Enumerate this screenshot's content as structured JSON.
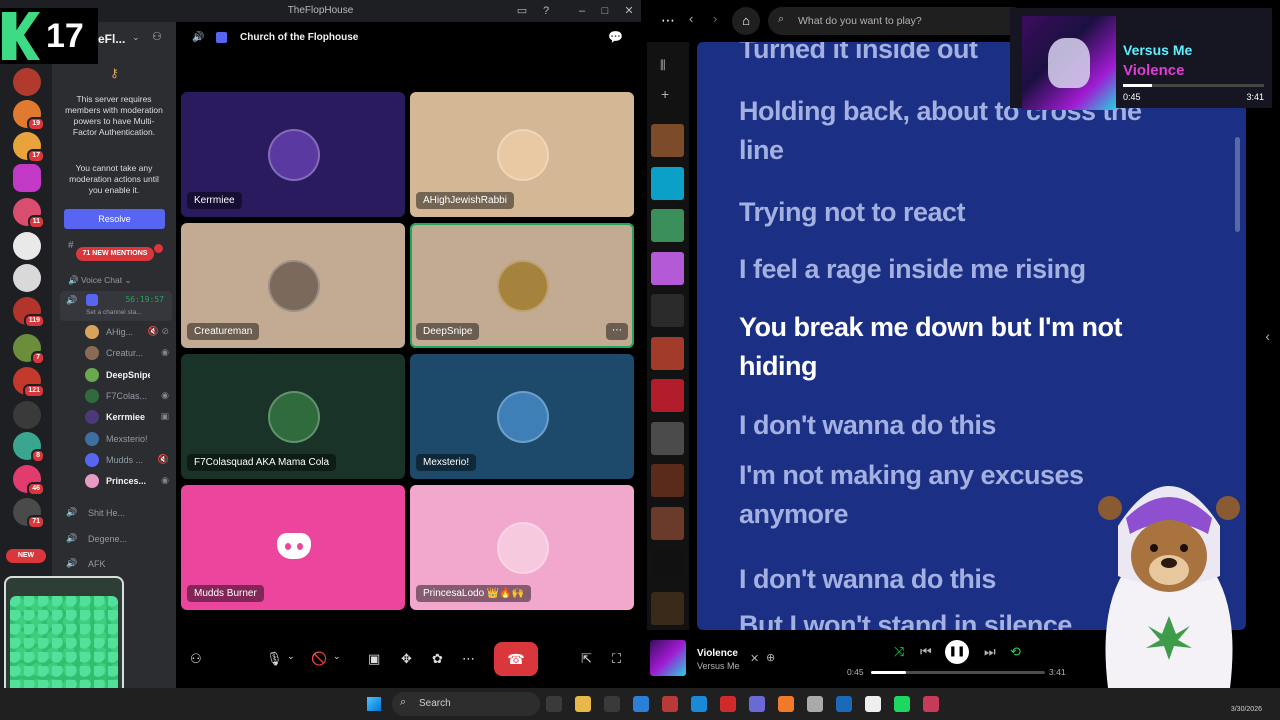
{
  "overlay": {
    "channel_number": "17"
  },
  "discord": {
    "window_title": "TheFlopHouse",
    "server_name_partial": "eFl...",
    "mfa_notice": "This server requires members with moderation powers to have Multi-Factor Authentication.",
    "mfa_notice2": "You cannot take any moderation actions until you enable it.",
    "resolve_label": "Resolve",
    "new_mentions": "71 NEW MENTIONS",
    "voice_category": "Voice Chat",
    "active_channel_timer": "56:19:57",
    "active_channel_status": "Set a channel sta...",
    "voice_members": [
      {
        "name": "AHig...",
        "bold": false,
        "icons": "🔇 ⊘",
        "color": "#d9a35c"
      },
      {
        "name": "Creatur...",
        "bold": false,
        "icons": "◉",
        "color": "#8a6a55"
      },
      {
        "name": "DeepSnipe",
        "bold": true,
        "icons": "",
        "color": "#6aa84f"
      },
      {
        "name": "F7Colas...",
        "bold": false,
        "icons": "◉",
        "color": "#2f6b3c"
      },
      {
        "name": "Kerrmiee",
        "bold": true,
        "icons": "▣",
        "color": "#4a3a7a"
      },
      {
        "name": "Mexsterio!",
        "bold": false,
        "icons": "",
        "color": "#3e6fa3"
      },
      {
        "name": "Mudds ...",
        "bold": false,
        "icons": "🔇",
        "color": "#5865f2"
      },
      {
        "name": "Princes...",
        "bold": true,
        "icons": "◉",
        "color": "#e79ac3"
      }
    ],
    "other_voice_channels": [
      {
        "name": "Shit He..."
      },
      {
        "name": "Degene..."
      },
      {
        "name": "AFK"
      }
    ],
    "stage_channel": "Church of the Flophouse",
    "guild_badges": [
      "19",
      "17",
      "11",
      "119",
      "7",
      "121",
      "8",
      "46",
      "71"
    ],
    "new_badge": "NEW",
    "tiles": [
      {
        "name": "Kerrmiee",
        "bg": "#2a1a5e",
        "speaking": false,
        "avatar": "#5a3aa0"
      },
      {
        "name": "AHighJewishRabbi",
        "bg": "#d4b896",
        "speaking": false,
        "avatar": "#e8c9a4"
      },
      {
        "name": "Creatureman",
        "bg": "#c3ab93",
        "speaking": false,
        "avatar": "#7b6a5c"
      },
      {
        "name": "DeepSnipe",
        "bg": "#c3ab93",
        "speaking": true,
        "avatar": "#a5833d"
      },
      {
        "name": "F7Colasquad AKA Mama Cola",
        "bg": "#1a3329",
        "speaking": false,
        "avatar": "#2f6b3c"
      },
      {
        "name": "Mexsterio!",
        "bg": "#1d4a6b",
        "speaking": false,
        "avatar": "#3e7fb8"
      },
      {
        "name": "Mudds Burner",
        "bg": "#eb459e",
        "speaking": false,
        "avatar": ""
      },
      {
        "name": "PrincesaLodo 👑🔥🙌",
        "bg": "#f2a7cc",
        "speaking": false,
        "avatar": "#f6c9df"
      }
    ]
  },
  "spotify": {
    "search_placeholder": "What do you want to play?",
    "lyrics": [
      {
        "text": "Turned it inside out",
        "active": false
      },
      {
        "text": "Holding back, about to cross the line",
        "active": false
      },
      {
        "text": "Trying not to react",
        "active": false
      },
      {
        "text": "I feel a rage inside me rising",
        "active": false
      },
      {
        "text": "You break me down but I'm not hiding",
        "active": true
      },
      {
        "text": "I don't wanna do this",
        "active": false
      },
      {
        "text": "I'm not making any excuses anymore",
        "active": false
      },
      {
        "text": "I don't wanna do this",
        "active": false
      },
      {
        "text": "But I won't stand in silence",
        "active": false
      }
    ],
    "mini_player": {
      "artist": "Versus Me",
      "title": "Violence",
      "elapsed": "0:45",
      "total": "3:41",
      "progress": 0.203
    },
    "now_playing": {
      "title": "Violence",
      "artist": "Versus Me",
      "elapsed": "0:45",
      "total": "3:41",
      "progress": 0.203
    }
  },
  "taskbar": {
    "search_label": "Search",
    "date": "3/30/2026"
  },
  "colors": {
    "discord_bg": "#1e1f22",
    "discord_accent": "#5865f2",
    "danger": "#da373c",
    "speaking": "#23a55a",
    "lyrics_bg": "#1b2f84",
    "spotify_green": "#1ed760"
  }
}
